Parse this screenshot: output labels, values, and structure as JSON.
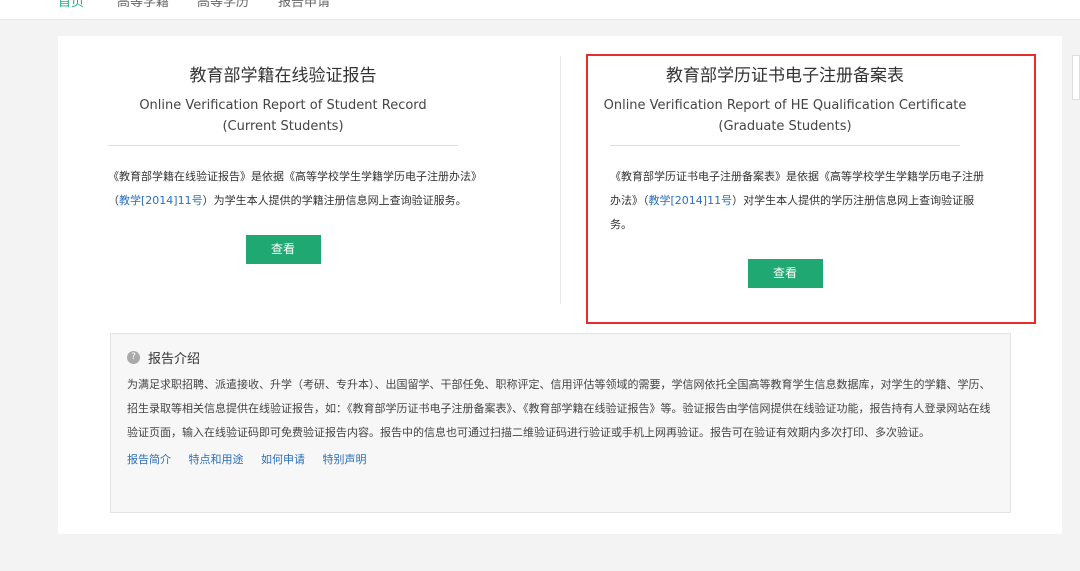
{
  "nav": [
    "首页",
    "高等学籍",
    "高等学历",
    "报告申请"
  ],
  "cards": [
    {
      "title": "教育部学籍在线验证报告",
      "en1": "Online Verification Report of Student Record",
      "en2": "(Current Students)",
      "desc_a": "《教育部学籍在线验证报告》是依据《高等学校学生学籍学历电子注册办法》（",
      "desc_link": "教学[2014]11号",
      "desc_b": "）为学生本人提供的学籍注册信息网上查询验证服务。",
      "button": "查看"
    },
    {
      "title": "教育部学历证书电子注册备案表",
      "en1": "Online Verification Report of HE Qualification Certificate",
      "en2": "(Graduate Students)",
      "desc_a": "《教育部学历证书电子注册备案表》是依据《高等学校学生学籍学历电子注册办法》（",
      "desc_link": "教学[2014]11号",
      "desc_b": "）对学生本人提供的学历注册信息网上查询验证服务。",
      "button": "查看"
    }
  ],
  "intro": {
    "title": "报告介绍",
    "text": "为满足求职招聘、派遣接收、升学（考研、专升本）、出国留学、干部任免、职称评定、信用评估等领域的需要，学信网依托全国高等教育学生信息数据库，对学生的学籍、学历、招生录取等相关信息提供在线验证报告，如：《教育部学历证书电子注册备案表》、《教育部学籍在线验证报告》等。验证报告由学信网提供在线验证功能，报告持有人登录网站在线验证页面，输入在线验证码即可免费验证报告内容。报告中的信息也可通过扫描二维验证码进行验证或手机上网再验证。报告可在验证有效期内多次打印、多次验证。",
    "links": [
      "报告简介",
      "特点和用途",
      "如何申请",
      "特别声明"
    ]
  },
  "colors": {
    "accent": "#1fa871",
    "highlight": "#e82b2b",
    "link": "#2a6fb8"
  }
}
